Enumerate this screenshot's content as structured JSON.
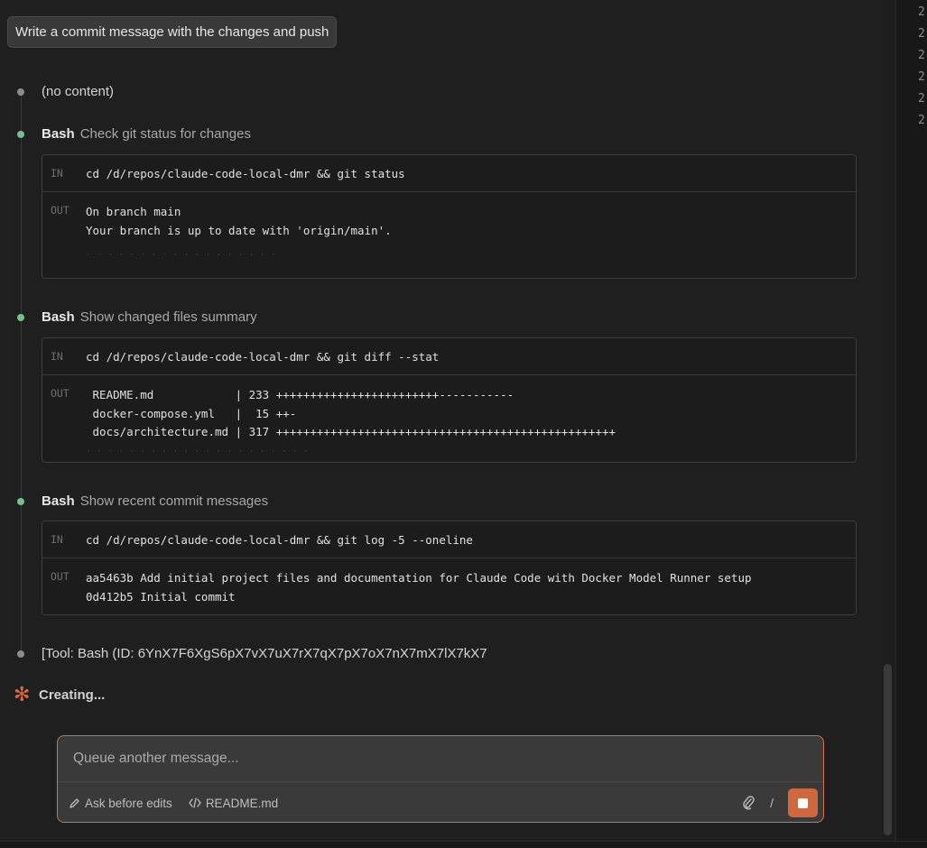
{
  "user_message": "Write a commit message with the changes and push",
  "timeline": {
    "no_content": "(no content)",
    "steps": [
      {
        "tool": "Bash",
        "description": "Check git status for changes",
        "in_label": "IN",
        "command": "cd /d/repos/claude-code-local-dmr && git status",
        "out_label": "OUT",
        "output": "On branch main\nYour branch is up to date with 'origin/main'."
      },
      {
        "tool": "Bash",
        "description": "Show changed files summary",
        "in_label": "IN",
        "command": "cd /d/repos/claude-code-local-dmr && git diff --stat",
        "out_label": "OUT",
        "output": " README.md            | 233 ++++++++++++++++++++++++-----------\n docker-compose.yml   |  15 ++-\n docs/architecture.md | 317 ++++++++++++++++++++++++++++++++++++++++++++++++++"
      },
      {
        "tool": "Bash",
        "description": "Show recent commit messages",
        "in_label": "IN",
        "command": "cd /d/repos/claude-code-local-dmr && git log -5 --oneline",
        "out_label": "OUT",
        "output": "aa5463b Add initial project files and documentation for Claude Code with Docker Model Runner setup\n0d412b5 Initial commit"
      }
    ],
    "tool_call": "[Tool: Bash (ID: 6YnX7F6XgS6pX7vX7uX7rX7qX7pX7oX7nX7mX7lX7kX7"
  },
  "status": {
    "label": "Creating..."
  },
  "composer": {
    "placeholder": "Queue another message...",
    "mode_label": "Ask before edits",
    "file_label": "README.md",
    "slash": "/"
  },
  "side_panel": {
    "line_numbers": [
      "2",
      "2",
      "2",
      "2",
      "2",
      "2"
    ]
  },
  "colors": {
    "accent": "#d0683f",
    "success_dot": "#74c08c",
    "neutral_dot": "#8c8c8c"
  }
}
